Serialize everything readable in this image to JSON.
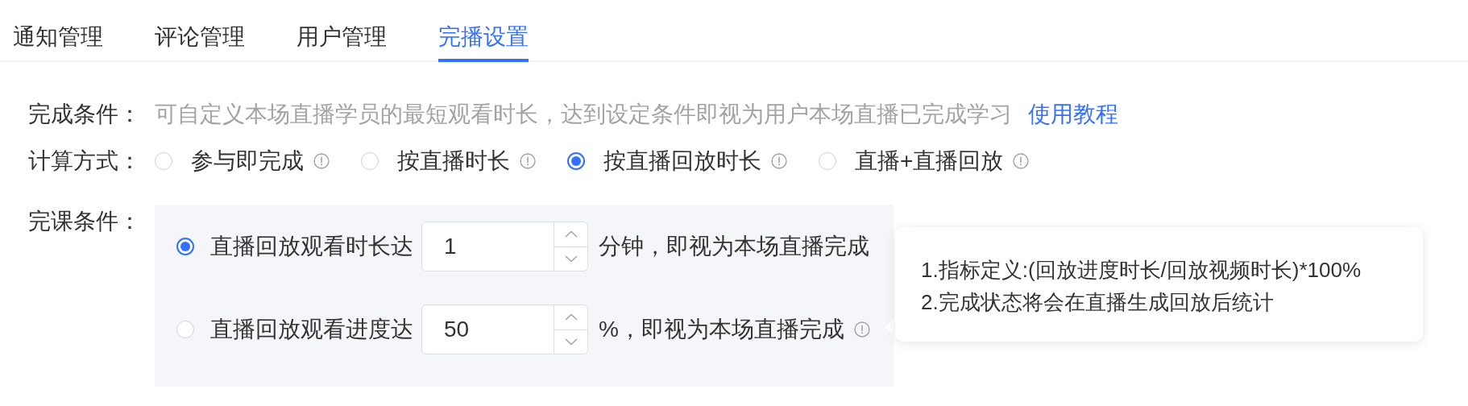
{
  "tabs": [
    {
      "label": "通知管理",
      "selected": false
    },
    {
      "label": "评论管理",
      "selected": false
    },
    {
      "label": "用户管理",
      "selected": false
    },
    {
      "label": "完播设置",
      "selected": true
    }
  ],
  "completion_condition": {
    "label": "完成条件：",
    "description": "可自定义本场直播学员的最短观看时长，达到设定条件即视为用户本场直播已完成学习",
    "link": "使用教程"
  },
  "calculation_method": {
    "label": "计算方式：",
    "options": [
      {
        "label": "参与即完成",
        "selected": false
      },
      {
        "label": "按直播时长",
        "selected": false
      },
      {
        "label": "按直播回放时长",
        "selected": true
      },
      {
        "label": "直播+直播回放",
        "selected": false
      }
    ]
  },
  "course_condition": {
    "label": "完课条件：",
    "options": [
      {
        "label": "直播回放观看时长达",
        "selected": true,
        "value": "1",
        "suffix": "分钟，即视为本场直播完成",
        "info_icon": false
      },
      {
        "label": "直播回放观看进度达",
        "selected": false,
        "value": "50",
        "suffix": "%，即视为本场直播完成",
        "info_icon": true
      }
    ]
  },
  "tooltip": {
    "lines": [
      "1.指标定义:(回放进度时长/回放视频时长)*100%",
      "2.完成状态将会在直播生成回放后统计"
    ]
  }
}
